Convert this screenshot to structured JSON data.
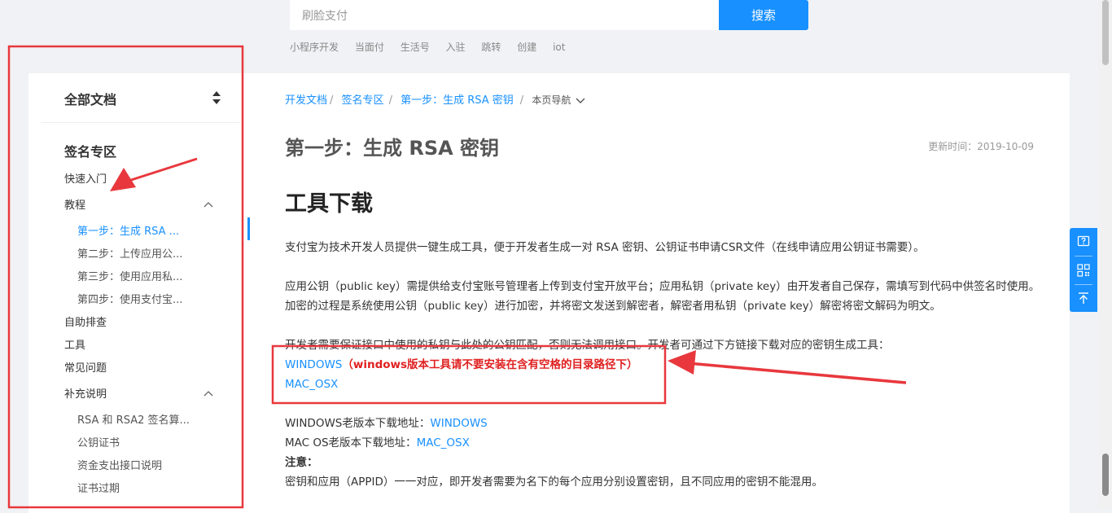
{
  "search": {
    "placeholder": "刷脸支付",
    "button_label": "搜索"
  },
  "hot_links": [
    "小程序开发",
    "当面付",
    "生活号",
    "入驻",
    "跳转",
    "创建",
    "iot"
  ],
  "sidebar": {
    "header": "全部文档",
    "section_title": "签名专区",
    "items": [
      {
        "label": "快速入门"
      },
      {
        "label": "教程"
      },
      {
        "label": "第一步：生成 RSA ..."
      },
      {
        "label": "第二步：上传应用公..."
      },
      {
        "label": "第三步：使用应用私..."
      },
      {
        "label": "第四步：使用支付宝..."
      },
      {
        "label": "自助排查"
      },
      {
        "label": "工具"
      },
      {
        "label": "常见问题"
      },
      {
        "label": "补充说明"
      },
      {
        "label": "RSA 和 RSA2 签名算..."
      },
      {
        "label": "公钥证书"
      },
      {
        "label": "资金支出接口说明"
      },
      {
        "label": "证书过期"
      }
    ]
  },
  "breadcrumb": {
    "items": [
      "开发文档",
      "签名专区",
      "第一步：生成 RSA 密钥"
    ],
    "page_nav": "本页导航"
  },
  "page": {
    "title": "第一步：生成 RSA 密钥",
    "update_time": "更新时间：2019-10-09",
    "section_heading": "工具下载",
    "p1": "支付宝为技术开发人员提供一键生成工具，便于开发者生成一对 RSA 密钥、公钥证书申请CSR文件（在线申请应用公钥证书需要）。",
    "p2": "应用公钥（public key）需提供给支付宝账号管理者上传到支付宝开放平台；应用私钥（private key）由开发者自己保存，需填写到代码中供签名时使用。加密的过程是系统使用公钥（public key）进行加密，并将密文发送到解密者，解密者用私钥（private key）解密将密文解码为明文。",
    "p3": "开发者需要保证接口中使用的私钥与此处的公钥匹配，否则无法调用接口。开发者可通过下方链接下载对应的密钥生成工具：",
    "windows_link": "WINDOWS",
    "windows_warning": "（windows版本工具请不要安装在含有空格的目录路径下）",
    "mac_link": "MAC_OSX",
    "old_windows_label": "WINDOWS老版本下载地址：",
    "old_windows_link": "WINDOWS",
    "old_mac_label": "MAC OS老版本下载地址：",
    "old_mac_link": "MAC_OSX",
    "note_label": "注意：",
    "note_text": "密钥和应用（APPID）一一对应，即开发者需要为名下的每个应用分别设置密钥，且不同应用的密钥不能混用。"
  },
  "float_toolbar": {
    "icons": [
      "question-icon",
      "qrcode-icon",
      "back-to-top-icon"
    ],
    "color": "#1890ff"
  },
  "colors": {
    "accent": "#1890ff",
    "annotation": "#e02020",
    "warning": "#e02020"
  }
}
